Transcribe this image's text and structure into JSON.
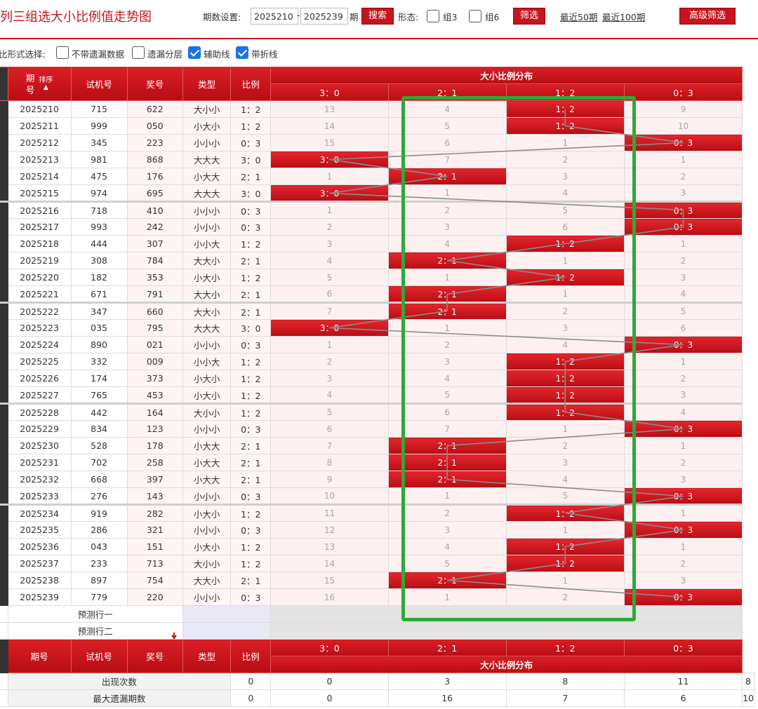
{
  "header": {
    "title": "列三组选大小比例值走势图",
    "period_setting_label": "期数设置:",
    "period_from": "2025210",
    "period_dash": "-",
    "period_to": "2025239",
    "period_unit": "期",
    "search_label": "搜索",
    "form_label": "形态:",
    "group3_label": "组3",
    "group6_label": "组6",
    "filter_label": "筛选",
    "recent50_label": "最近50期",
    "recent100_label": "最近100期",
    "advanced_label": "高级筛选"
  },
  "options": {
    "label": "比形式选择:",
    "no_miss_label": "不带遗漏数据",
    "miss_layer_label": "遗漏分层",
    "aux_line_label": "辅助线",
    "fold_line_label": "带折线",
    "no_miss_checked": false,
    "miss_layer_checked": false,
    "aux_line_checked": true,
    "fold_line_checked": true
  },
  "table": {
    "head": {
      "period": "期\n号",
      "sort": "排序",
      "trial": "试机号",
      "prize": "奖号",
      "type": "类型",
      "ratio": "比例",
      "dist_group": "大小比例分布",
      "dist_cols": [
        "3：0",
        "2：1",
        "1：2",
        "0：3"
      ]
    },
    "rows": [
      {
        "period": "2025210",
        "trial": "715",
        "prize": "622",
        "type": "大小小",
        "ratio": "1：2",
        "dist": [
          "13",
          "4",
          "1：2",
          "9"
        ],
        "hit": 2
      },
      {
        "period": "2025211",
        "trial": "999",
        "prize": "050",
        "type": "小大小",
        "ratio": "1：2",
        "dist": [
          "14",
          "5",
          "1：2",
          "10"
        ],
        "hit": 2
      },
      {
        "period": "2025212",
        "trial": "345",
        "prize": "223",
        "type": "小小小",
        "ratio": "0：3",
        "dist": [
          "15",
          "6",
          "1",
          "0：3"
        ],
        "hit": 3
      },
      {
        "period": "2025213",
        "trial": "981",
        "prize": "868",
        "type": "大大大",
        "ratio": "3：0",
        "dist": [
          "3：0",
          "7",
          "2",
          "1"
        ],
        "hit": 0
      },
      {
        "period": "2025214",
        "trial": "475",
        "prize": "176",
        "type": "小大大",
        "ratio": "2：1",
        "dist": [
          "1",
          "2：1",
          "3",
          "2"
        ],
        "hit": 1
      },
      {
        "period": "2025215",
        "trial": "974",
        "prize": "695",
        "type": "大大大",
        "ratio": "3：0",
        "dist": [
          "3：0",
          "1",
          "4",
          "3"
        ],
        "hit": 0
      },
      {
        "period": "2025216",
        "trial": "718",
        "prize": "410",
        "type": "小小小",
        "ratio": "0：3",
        "dist": [
          "1",
          "2",
          "5",
          "0：3"
        ],
        "hit": 3
      },
      {
        "period": "2025217",
        "trial": "993",
        "prize": "242",
        "type": "小小小",
        "ratio": "0：3",
        "dist": [
          "2",
          "3",
          "6",
          "0：3"
        ],
        "hit": 3
      },
      {
        "period": "2025218",
        "trial": "444",
        "prize": "307",
        "type": "小小大",
        "ratio": "1：2",
        "dist": [
          "3",
          "4",
          "1：2",
          "1"
        ],
        "hit": 2
      },
      {
        "period": "2025219",
        "trial": "308",
        "prize": "784",
        "type": "大大小",
        "ratio": "2：1",
        "dist": [
          "4",
          "2：1",
          "1",
          "2"
        ],
        "hit": 1
      },
      {
        "period": "2025220",
        "trial": "182",
        "prize": "353",
        "type": "小大小",
        "ratio": "1：2",
        "dist": [
          "5",
          "1",
          "1：2",
          "3"
        ],
        "hit": 2
      },
      {
        "period": "2025221",
        "trial": "671",
        "prize": "791",
        "type": "大大小",
        "ratio": "2：1",
        "dist": [
          "6",
          "2：1",
          "1",
          "4"
        ],
        "hit": 1
      },
      {
        "period": "2025222",
        "trial": "347",
        "prize": "660",
        "type": "大大小",
        "ratio": "2：1",
        "dist": [
          "7",
          "2：1",
          "2",
          "5"
        ],
        "hit": 1
      },
      {
        "period": "2025223",
        "trial": "035",
        "prize": "795",
        "type": "大大大",
        "ratio": "3：0",
        "dist": [
          "3：0",
          "1",
          "3",
          "6"
        ],
        "hit": 0
      },
      {
        "period": "2025224",
        "trial": "890",
        "prize": "021",
        "type": "小小小",
        "ratio": "0：3",
        "dist": [
          "1",
          "2",
          "4",
          "0：3"
        ],
        "hit": 3
      },
      {
        "period": "2025225",
        "trial": "332",
        "prize": "009",
        "type": "小小大",
        "ratio": "1：2",
        "dist": [
          "2",
          "3",
          "1：2",
          "1"
        ],
        "hit": 2
      },
      {
        "period": "2025226",
        "trial": "174",
        "prize": "373",
        "type": "小大小",
        "ratio": "1：2",
        "dist": [
          "3",
          "4",
          "1：2",
          "2"
        ],
        "hit": 2
      },
      {
        "period": "2025227",
        "trial": "765",
        "prize": "453",
        "type": "小大小",
        "ratio": "1：2",
        "dist": [
          "4",
          "5",
          "1：2",
          "3"
        ],
        "hit": 2
      },
      {
        "period": "2025228",
        "trial": "442",
        "prize": "164",
        "type": "大小小",
        "ratio": "1：2",
        "dist": [
          "5",
          "6",
          "1：2",
          "4"
        ],
        "hit": 2
      },
      {
        "period": "2025229",
        "trial": "834",
        "prize": "123",
        "type": "小小小",
        "ratio": "0：3",
        "dist": [
          "6",
          "7",
          "1",
          "0：3"
        ],
        "hit": 3
      },
      {
        "period": "2025230",
        "trial": "528",
        "prize": "178",
        "type": "小大大",
        "ratio": "2：1",
        "dist": [
          "7",
          "2：1",
          "2",
          "1"
        ],
        "hit": 1
      },
      {
        "period": "2025231",
        "trial": "702",
        "prize": "258",
        "type": "小大大",
        "ratio": "2：1",
        "dist": [
          "8",
          "2：1",
          "3",
          "2"
        ],
        "hit": 1
      },
      {
        "period": "2025232",
        "trial": "668",
        "prize": "397",
        "type": "小大大",
        "ratio": "2：1",
        "dist": [
          "9",
          "2：1",
          "4",
          "3"
        ],
        "hit": 1
      },
      {
        "period": "2025233",
        "trial": "276",
        "prize": "143",
        "type": "小小小",
        "ratio": "0：3",
        "dist": [
          "10",
          "1",
          "5",
          "0：3"
        ],
        "hit": 3
      },
      {
        "period": "2025234",
        "trial": "919",
        "prize": "282",
        "type": "小大小",
        "ratio": "1：2",
        "dist": [
          "11",
          "2",
          "1：2",
          "1"
        ],
        "hit": 2
      },
      {
        "period": "2025235",
        "trial": "286",
        "prize": "321",
        "type": "小小小",
        "ratio": "0：3",
        "dist": [
          "12",
          "3",
          "1",
          "0：3"
        ],
        "hit": 3
      },
      {
        "period": "2025236",
        "trial": "043",
        "prize": "151",
        "type": "小大小",
        "ratio": "1：2",
        "dist": [
          "13",
          "4",
          "1：2",
          "1"
        ],
        "hit": 2
      },
      {
        "period": "2025237",
        "trial": "233",
        "prize": "713",
        "type": "大小小",
        "ratio": "1：2",
        "dist": [
          "14",
          "5",
          "1：2",
          "2"
        ],
        "hit": 2
      },
      {
        "period": "2025238",
        "trial": "897",
        "prize": "754",
        "type": "大大小",
        "ratio": "2：1",
        "dist": [
          "15",
          "2：1",
          "1",
          "3"
        ],
        "hit": 1
      },
      {
        "period": "2025239",
        "trial": "779",
        "prize": "220",
        "type": "小小小",
        "ratio": "0：3",
        "dist": [
          "16",
          "1",
          "2",
          "0：3"
        ],
        "hit": 3
      }
    ],
    "predict": [
      "预测行一",
      "预测行二"
    ],
    "foot": {
      "period": "期号",
      "trial": "试机号",
      "prize": "奖号",
      "type": "类型",
      "ratio": "比例",
      "dist_cols": [
        "3：0",
        "2：1",
        "1：2",
        "0：3"
      ],
      "dist_group": "大小比例分布"
    },
    "stats": [
      {
        "label": "出现次数",
        "type": "0",
        "ratio": "0",
        "values": [
          "3",
          "8",
          "11",
          "8"
        ]
      },
      {
        "label": "最大遗漏期数",
        "type": "0",
        "ratio": "0",
        "values": [
          "16",
          "7",
          "6",
          "10"
        ]
      }
    ]
  },
  "colors": {
    "brand_red": "#c8141c",
    "highlight_green": "#2ea83a",
    "trend_line": "#8c8c8c"
  }
}
